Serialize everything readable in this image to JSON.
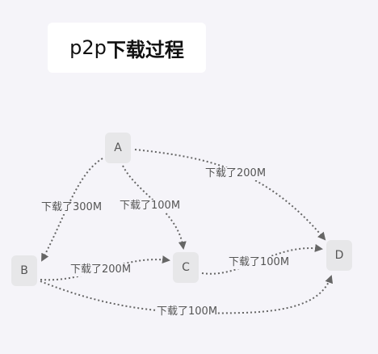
{
  "title": {
    "latin": "p2p",
    "cjk": "下载过程"
  },
  "nodes": {
    "A": "A",
    "B": "B",
    "C": "C",
    "D": "D"
  },
  "edges": [
    {
      "from": "A",
      "to": "B",
      "label": "下载了300M"
    },
    {
      "from": "A",
      "to": "C",
      "label": "下载了100M"
    },
    {
      "from": "A",
      "to": "D",
      "label": "下载了200M"
    },
    {
      "from": "B",
      "to": "C",
      "label": "下载了200M"
    },
    {
      "from": "C",
      "to": "D",
      "label": "下载了100M"
    },
    {
      "from": "B",
      "to": "D",
      "label": "下载了100M"
    }
  ],
  "colors": {
    "background": "#f5f4f9",
    "node": "#e7e7e9",
    "edge": "#666666"
  }
}
